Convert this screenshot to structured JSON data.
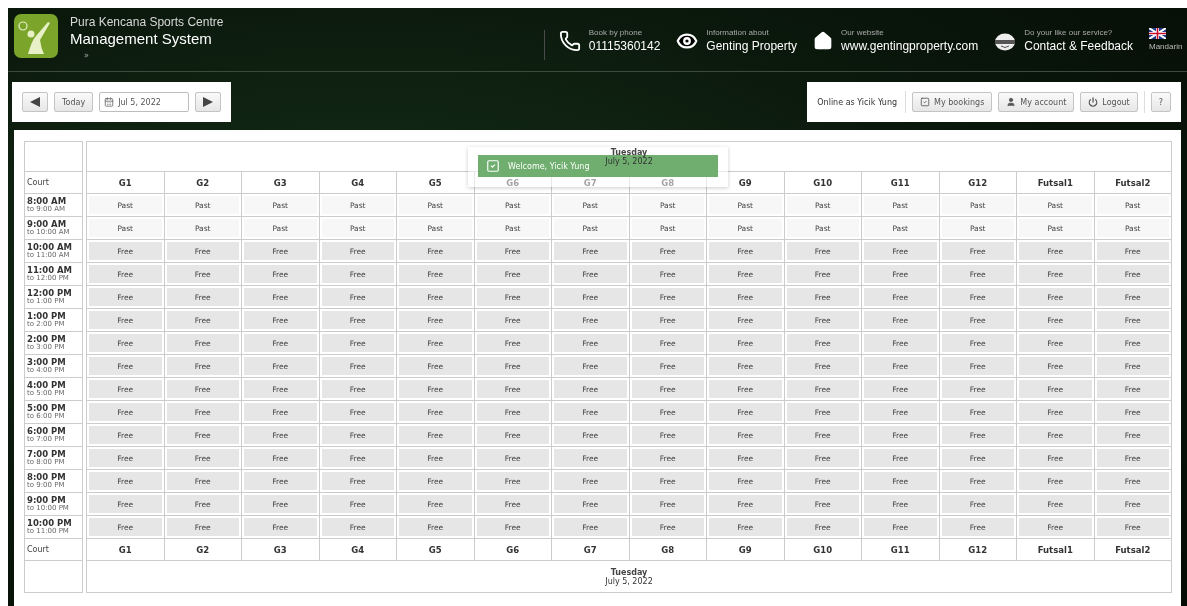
{
  "header": {
    "org": "Pura Kencana Sports Centre",
    "title": "Management System",
    "breadcrumb": "»",
    "contacts": [
      {
        "kind": "phone",
        "caption": "Book by phone",
        "value": "01115360142"
      },
      {
        "kind": "info",
        "caption": "Information about",
        "value": "Genting Property"
      },
      {
        "kind": "website",
        "caption": "Our website",
        "value": "www.gentingproperty.com"
      },
      {
        "kind": "feedback",
        "caption": "Do your like our service?",
        "value": "Contact & Feedback"
      }
    ],
    "language": {
      "alt_text": "Mandarin"
    }
  },
  "toolbar": {
    "today": "Today",
    "date": "Jul 5, 2022"
  },
  "user_bar": {
    "status": "Online as Yicik Yung",
    "buttons": [
      {
        "kind": "bookings",
        "label": "My bookings"
      },
      {
        "kind": "account",
        "label": "My account"
      },
      {
        "kind": "logout",
        "label": "Logout"
      }
    ],
    "help": "?"
  },
  "toast": {
    "message": "Welcome, Yicik Yung"
  },
  "schedule": {
    "day": "Tuesday",
    "date": "July 5, 2022",
    "court_label": "Court",
    "courts": [
      "G1",
      "G2",
      "G3",
      "G4",
      "G5",
      "G6",
      "G7",
      "G8",
      "G9",
      "G10",
      "G11",
      "G12",
      "Futsal1",
      "Futsal2"
    ],
    "rows": [
      {
        "start": "8:00 AM",
        "end": "to 9:00 AM",
        "past": true,
        "slots": [
          "Past",
          "Past",
          "Past",
          "Past",
          "Past",
          "Past",
          "Past",
          "Past",
          "Past",
          "Past",
          "Past",
          "Past",
          "Past",
          "Past"
        ]
      },
      {
        "start": "9:00 AM",
        "end": "to 10:00 AM",
        "past": true,
        "slots": [
          "Past",
          "Past",
          "Past",
          "Past",
          "Past",
          "Past",
          "Past",
          "Past",
          "Past",
          "Past",
          "Past",
          "Past",
          "Past",
          "Past"
        ]
      },
      {
        "start": "10:00 AM",
        "end": "to 11:00 AM",
        "past": false,
        "slots": [
          "Free",
          "Free",
          "Free",
          "Free",
          "Free",
          "Free",
          "Free",
          "Free",
          "Free",
          "Free",
          "Free",
          "Free",
          "Free",
          "Free"
        ]
      },
      {
        "start": "11:00 AM",
        "end": "to 12:00 PM",
        "past": false,
        "slots": [
          "Free",
          "Free",
          "Free",
          "Free",
          "Free",
          "Free",
          "Free",
          "Free",
          "Free",
          "Free",
          "Free",
          "Free",
          "Free",
          "Free"
        ]
      },
      {
        "start": "12:00 PM",
        "end": "to 1:00 PM",
        "past": false,
        "slots": [
          "Free",
          "Free",
          "Free",
          "Free",
          "Free",
          "Free",
          "Free",
          "Free",
          "Free",
          "Free",
          "Free",
          "Free",
          "Free",
          "Free"
        ]
      },
      {
        "start": "1:00 PM",
        "end": "to 2:00 PM",
        "past": false,
        "slots": [
          "Free",
          "Free",
          "Free",
          "Free",
          "Free",
          "Free",
          "Free",
          "Free",
          "Free",
          "Free",
          "Free",
          "Free",
          "Free",
          "Free"
        ]
      },
      {
        "start": "2:00 PM",
        "end": "to 3:00 PM",
        "past": false,
        "slots": [
          "Free",
          "Free",
          "Free",
          "Free",
          "Free",
          "Free",
          "Free",
          "Free",
          "Free",
          "Free",
          "Free",
          "Free",
          "Free",
          "Free"
        ]
      },
      {
        "start": "3:00 PM",
        "end": "to 4:00 PM",
        "past": false,
        "slots": [
          "Free",
          "Free",
          "Free",
          "Free",
          "Free",
          "Free",
          "Free",
          "Free",
          "Free",
          "Free",
          "Free",
          "Free",
          "Free",
          "Free"
        ]
      },
      {
        "start": "4:00 PM",
        "end": "to 5:00 PM",
        "past": false,
        "slots": [
          "Free",
          "Free",
          "Free",
          "Free",
          "Free",
          "Free",
          "Free",
          "Free",
          "Free",
          "Free",
          "Free",
          "Free",
          "Free",
          "Free"
        ]
      },
      {
        "start": "5:00 PM",
        "end": "to 6:00 PM",
        "past": false,
        "slots": [
          "Free",
          "Free",
          "Free",
          "Free",
          "Free",
          "Free",
          "Free",
          "Free",
          "Free",
          "Free",
          "Free",
          "Free",
          "Free",
          "Free"
        ]
      },
      {
        "start": "6:00 PM",
        "end": "to 7:00 PM",
        "past": false,
        "slots": [
          "Free",
          "Free",
          "Free",
          "Free",
          "Free",
          "Free",
          "Free",
          "Free",
          "Free",
          "Free",
          "Free",
          "Free",
          "Free",
          "Free"
        ]
      },
      {
        "start": "7:00 PM",
        "end": "to 8:00 PM",
        "past": false,
        "slots": [
          "Free",
          "Free",
          "Free",
          "Free",
          "Free",
          "Free",
          "Free",
          "Free",
          "Free",
          "Free",
          "Free",
          "Free",
          "Free",
          "Free"
        ]
      },
      {
        "start": "8:00 PM",
        "end": "to 9:00 PM",
        "past": false,
        "slots": [
          "Free",
          "Free",
          "Free",
          "Free",
          "Free",
          "Free",
          "Free",
          "Free",
          "Free",
          "Free",
          "Free",
          "Free",
          "Free",
          "Free"
        ]
      },
      {
        "start": "9:00 PM",
        "end": "to 10:00 PM",
        "past": false,
        "slots": [
          "Free",
          "Free",
          "Free",
          "Free",
          "Free",
          "Free",
          "Free",
          "Free",
          "Free",
          "Free",
          "Free",
          "Free",
          "Free",
          "Free"
        ]
      },
      {
        "start": "10:00 PM",
        "end": "to 11:00 PM",
        "past": false,
        "slots": [
          "Free",
          "Free",
          "Free",
          "Free",
          "Free",
          "Free",
          "Free",
          "Free",
          "Free",
          "Free",
          "Free",
          "Free",
          "Free",
          "Free"
        ]
      }
    ],
    "footer_court_label": "Court",
    "footer_courts": [
      "G1",
      "G2",
      "G3",
      "G4",
      "G5",
      "G6",
      "G7",
      "G8",
      "G9",
      "G10",
      "G11",
      "G12",
      "Futsal1",
      "Futsal2"
    ],
    "footer_day": "Tuesday",
    "footer_date": "July 5, 2022"
  }
}
